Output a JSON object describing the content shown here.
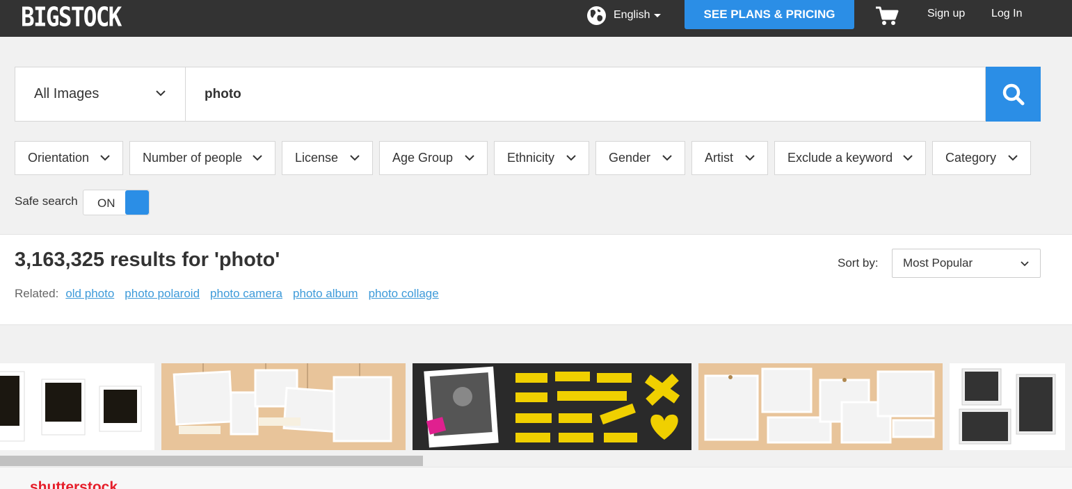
{
  "header": {
    "logo": "BIGSTOCK",
    "logo_tm": "™",
    "language": "English",
    "plans_button": "SEE PLANS & PRICING",
    "signup": "Sign up",
    "login": "Log In"
  },
  "search": {
    "type_value": "All Images",
    "query": "photo"
  },
  "filters": [
    "Orientation",
    "Number of people",
    "License",
    "Age Group",
    "Ethnicity",
    "Gender",
    "Artist",
    "Exclude a keyword",
    "Category"
  ],
  "safe_search": {
    "label": "Safe search",
    "state": "ON"
  },
  "results": {
    "heading": "3,163,325 results for 'photo'",
    "related_label": "Related:",
    "related_links": [
      "old photo",
      "photo polaroid",
      "photo camera",
      "photo album",
      "photo collage"
    ],
    "sort_label": "Sort by:",
    "sort_value": "Most Popular"
  },
  "footer_partner": "shutterstock",
  "colors": {
    "accent": "#2b8ee6",
    "nav_bg": "#333333",
    "link": "#3d9ad9"
  }
}
